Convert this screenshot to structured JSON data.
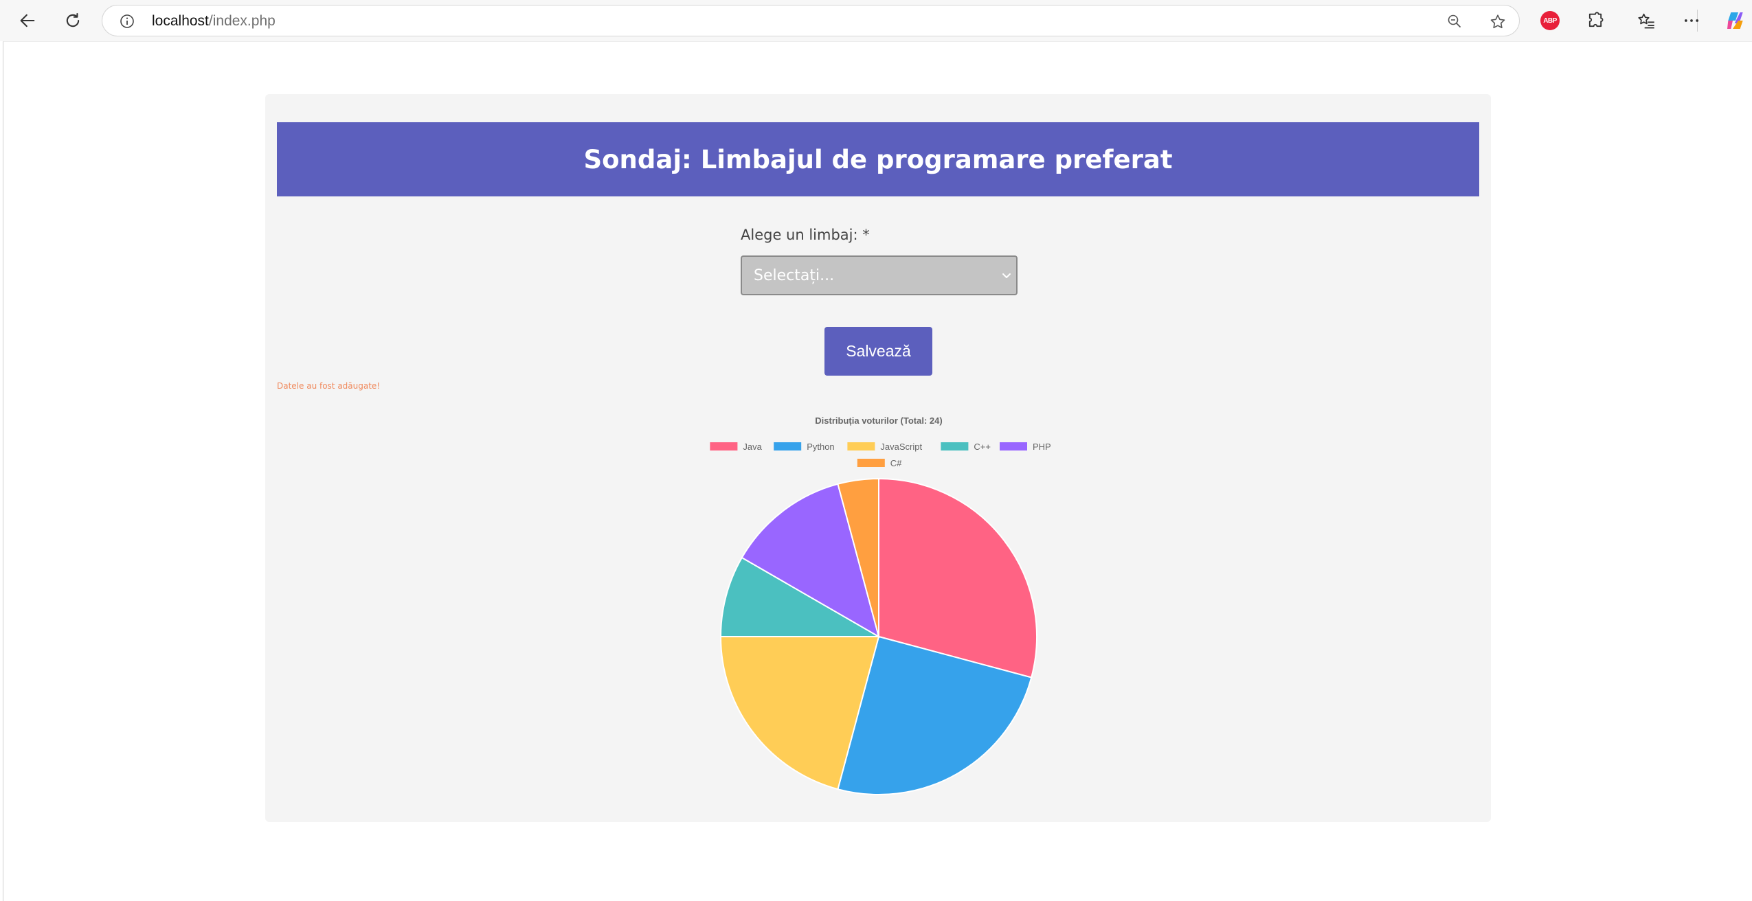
{
  "browser": {
    "url_host": "localhost",
    "url_path": "/index.php",
    "abp_label": "ABP"
  },
  "page": {
    "title": "Sondaj: Limbajul de programare preferat",
    "select_label": "Alege un limbaj: *",
    "select_value": "Selectați...",
    "save_label": "Salvează",
    "status_message": "Datele au fost adăugate!"
  },
  "chart_data": {
    "type": "pie",
    "title": "Distribuția voturilor (Total: 24)",
    "categories": [
      "Java",
      "Python",
      "JavaScript",
      "C++",
      "PHP",
      "C#"
    ],
    "values": [
      7,
      6,
      5,
      2,
      3,
      1
    ],
    "colors": [
      "#ff6384",
      "#36a2eb",
      "#ffcd56",
      "#4bc0c0",
      "#9966ff",
      "#ff9f40"
    ],
    "legend": "top"
  },
  "colors": {
    "accent": "#5c5fbd",
    "status": "#f08a5d",
    "container_bg": "#f4f4f4"
  }
}
